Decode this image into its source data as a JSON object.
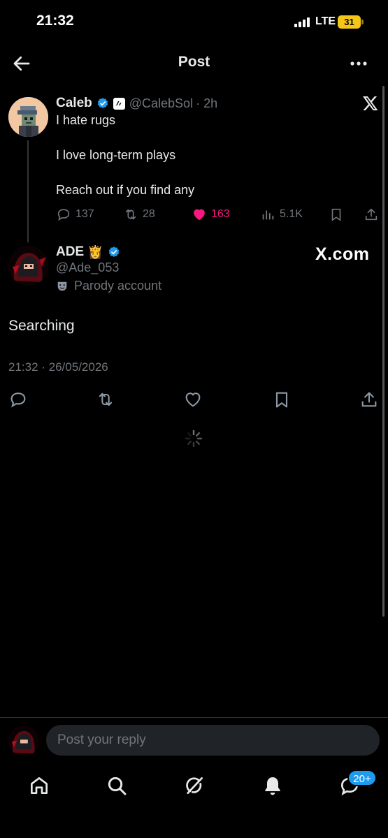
{
  "status_bar": {
    "time": "21:32",
    "network": "LTE",
    "battery": "31"
  },
  "header": {
    "title": "Post",
    "back_icon": "arrow-left-icon",
    "more_icon": "more-horizontal-icon"
  },
  "parent_post": {
    "display_name": "Caleb",
    "handle": "@CalebSol",
    "time": "· 2h",
    "lines": [
      "I hate rugs",
      "I love long-term plays",
      "Reach out if you find any"
    ],
    "replies": "137",
    "reposts": "28",
    "likes": "163",
    "views": "5.1K",
    "liked": true
  },
  "main_post": {
    "display_name": "ADE",
    "name_emoji": "👸",
    "handle": "@Ade_053",
    "parody_label": "Parody account",
    "watermark": "X.com",
    "text": "Searching",
    "timestamp": "21:32 · 26/05/2026"
  },
  "reply": {
    "placeholder": "Post your reply"
  },
  "bottom_nav": {
    "items": [
      "home-icon",
      "search-icon",
      "grok-icon",
      "notifications-icon",
      "messages-icon"
    ],
    "messages_badge": "20+"
  },
  "colors": {
    "background": "#000000",
    "text": "#e7e9ea",
    "muted": "#71767b",
    "verified": "#1d9bf0",
    "like": "#f91880",
    "battery": "#f5c518"
  }
}
